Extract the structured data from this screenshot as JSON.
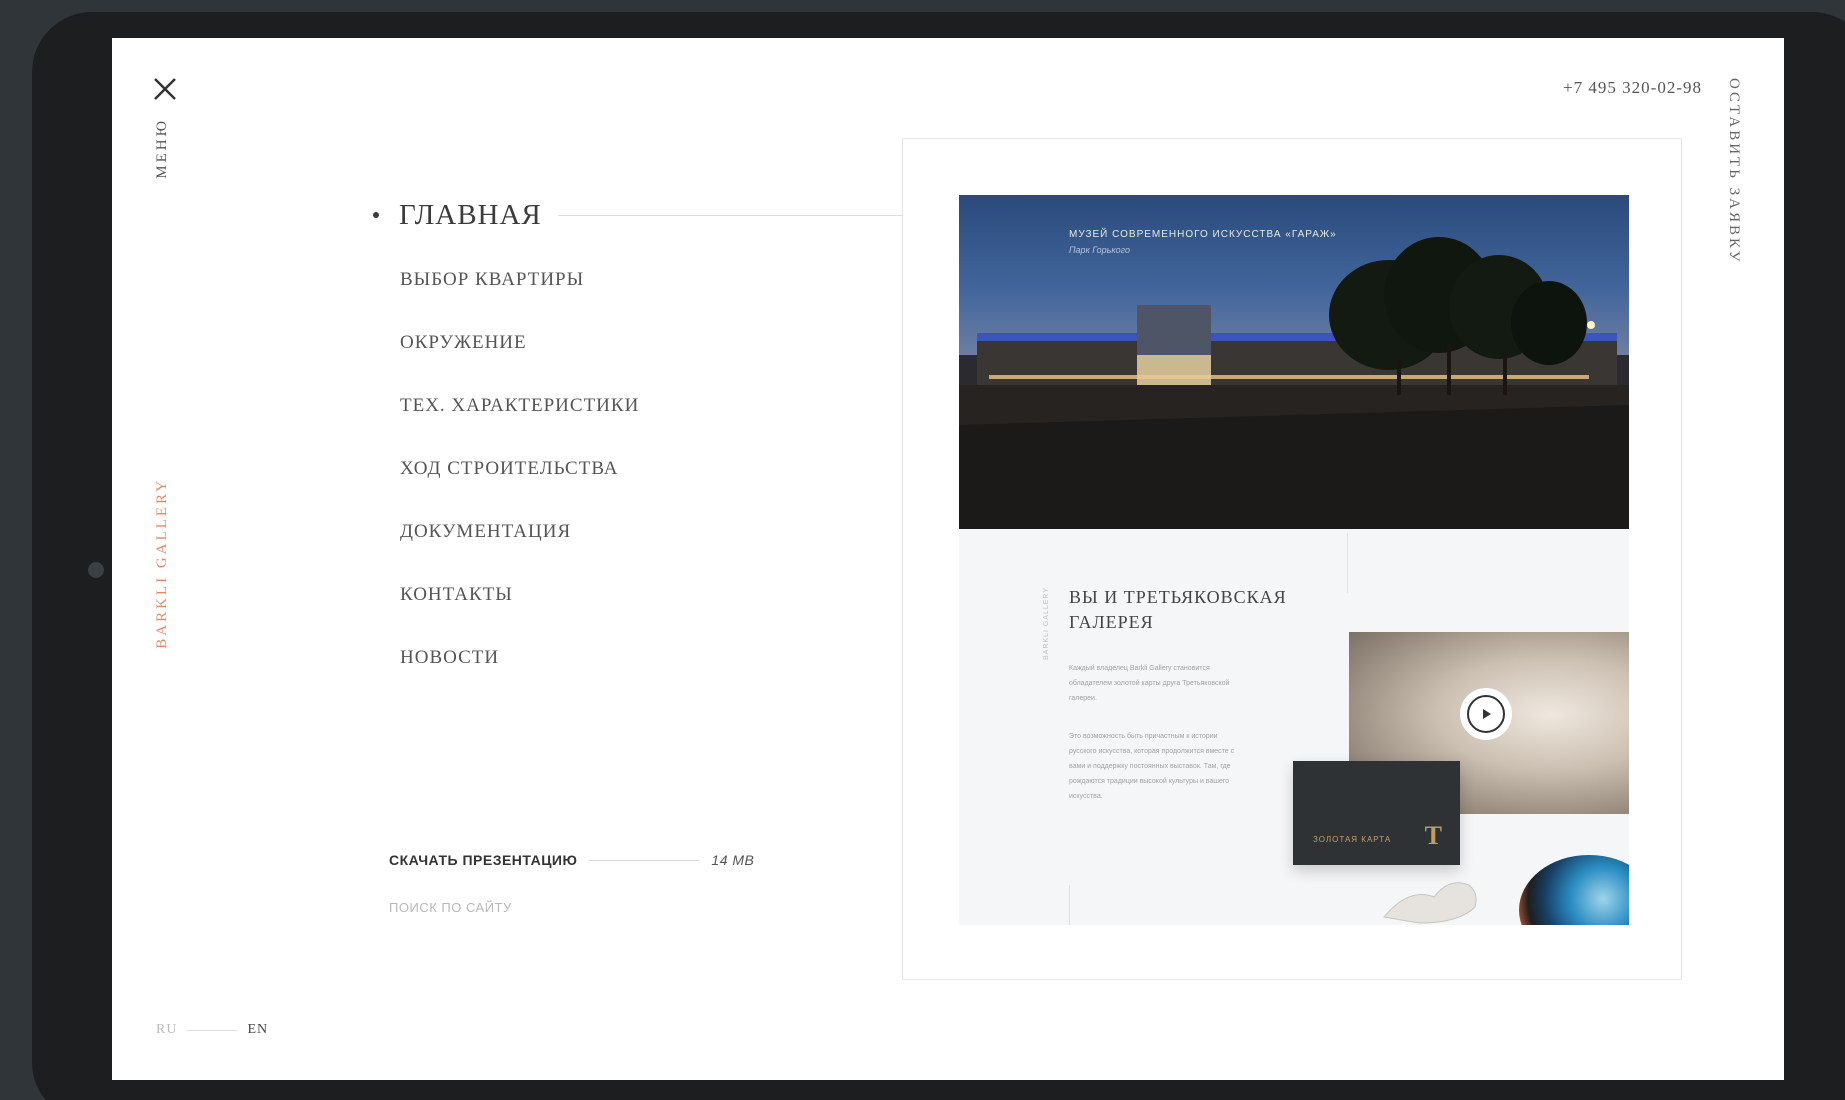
{
  "header": {
    "menu_label": "МЕНЮ",
    "phone": "+7 495 320-02-98",
    "cta_label": "ОСТАВИТЬ ЗАЯВКУ",
    "brand_label": "BARKLI GALLERY"
  },
  "nav": {
    "active": "ГЛАВНАЯ",
    "items": [
      "ВЫБОР КВАРТИРЫ",
      "ОКРУЖЕНИЕ",
      "ТЕХ. ХАРАКТЕРИСТИКИ",
      "ХОД СТРОИТЕЛЬСТВА",
      "ДОКУМЕНТАЦИЯ",
      "КОНТАКТЫ",
      "НОВОСТИ"
    ]
  },
  "download": {
    "label": "СКАЧАТЬ ПРЕЗЕНТАЦИЮ",
    "size": "14 MB"
  },
  "search": {
    "placeholder": "ПОИСК ПО САЙТУ"
  },
  "lang": {
    "ru": "RU",
    "en": "EN"
  },
  "preview": {
    "hero_title": "МУЗЕЙ СОВРЕМЕННОГО ИСКУССТВА «ГАРАЖ»",
    "hero_subtitle": "Парк Горького",
    "section_title": "ВЫ И ТРЕТЬЯКОВСКАЯ ГАЛЕРЕЯ",
    "section_side": "BARKLI GALLERY",
    "paragraph1": "Каждый владелец Barkli Gallery становится обладателем золотой карты друга Третьяковской галереи.",
    "paragraph2": "Это возможность быть причастным к истории русского искусства, которая продолжится вместе с вами и поддержку постоянных выставок. Там, где рождаются традиции высокой культуры и вашего искусства.",
    "card_label": "ЗОЛОТАЯ КАРТА",
    "card_logo": "T"
  },
  "colors": {
    "accent": "#e28a68",
    "gold": "#c99a5d",
    "card": "#2e3234"
  },
  "icons": {
    "close": "close-icon",
    "play": "play-icon"
  }
}
